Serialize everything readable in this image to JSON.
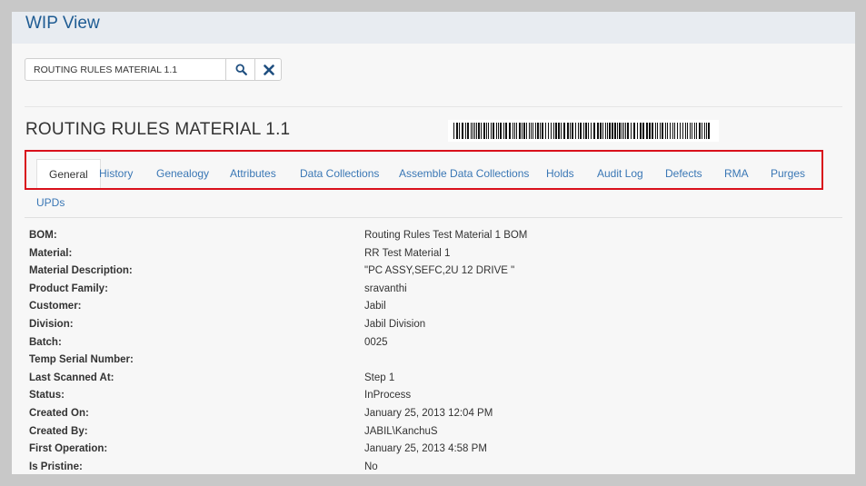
{
  "header": {
    "title": "WIP View"
  },
  "search": {
    "value": "ROUTING RULES MATERIAL 1.1",
    "search_icon": "search-icon",
    "clear_icon": "close-icon"
  },
  "material": {
    "title": "ROUTING RULES MATERIAL 1.1",
    "barcode_icon": "barcode-image"
  },
  "tabs": [
    {
      "label": "General",
      "active": true
    },
    {
      "label": "History"
    },
    {
      "label": "Genealogy"
    },
    {
      "label": "Attributes"
    },
    {
      "label": "Data Collections"
    },
    {
      "label": "Assemble Data Collections"
    },
    {
      "label": "Holds"
    },
    {
      "label": "Audit Log"
    },
    {
      "label": "Defects"
    },
    {
      "label": "RMA"
    },
    {
      "label": "Purges"
    },
    {
      "label": "UPDs"
    }
  ],
  "details": [
    {
      "label": "BOM:",
      "value": "Routing Rules Test Material 1 BOM"
    },
    {
      "label": "Material:",
      "value": "RR Test Material 1"
    },
    {
      "label": "Material Description:",
      "value": "\"PC ASSY,SEFC,2U 12 DRIVE \""
    },
    {
      "label": "Product Family:",
      "value": "sravanthi"
    },
    {
      "label": "Customer:",
      "value": "Jabil"
    },
    {
      "label": "Division:",
      "value": "Jabil Division"
    },
    {
      "label": "Batch:",
      "value": "0025"
    },
    {
      "label": "Temp Serial Number:",
      "value": ""
    },
    {
      "label": "Last Scanned At:",
      "value": "Step 1"
    },
    {
      "label": "Status:",
      "value": "InProcess"
    },
    {
      "label": "Created On:",
      "value": "January 25, 2013 12:04 PM"
    },
    {
      "label": "Created By:",
      "value": "JABIL\\KanchuS"
    },
    {
      "label": "First Operation:",
      "value": "January 25, 2013 4:58 PM"
    },
    {
      "label": "Is Pristine:",
      "value": "No"
    }
  ],
  "colors": {
    "accent": "#1f5c93",
    "link": "#3a77b5",
    "highlight": "#d9101b"
  }
}
